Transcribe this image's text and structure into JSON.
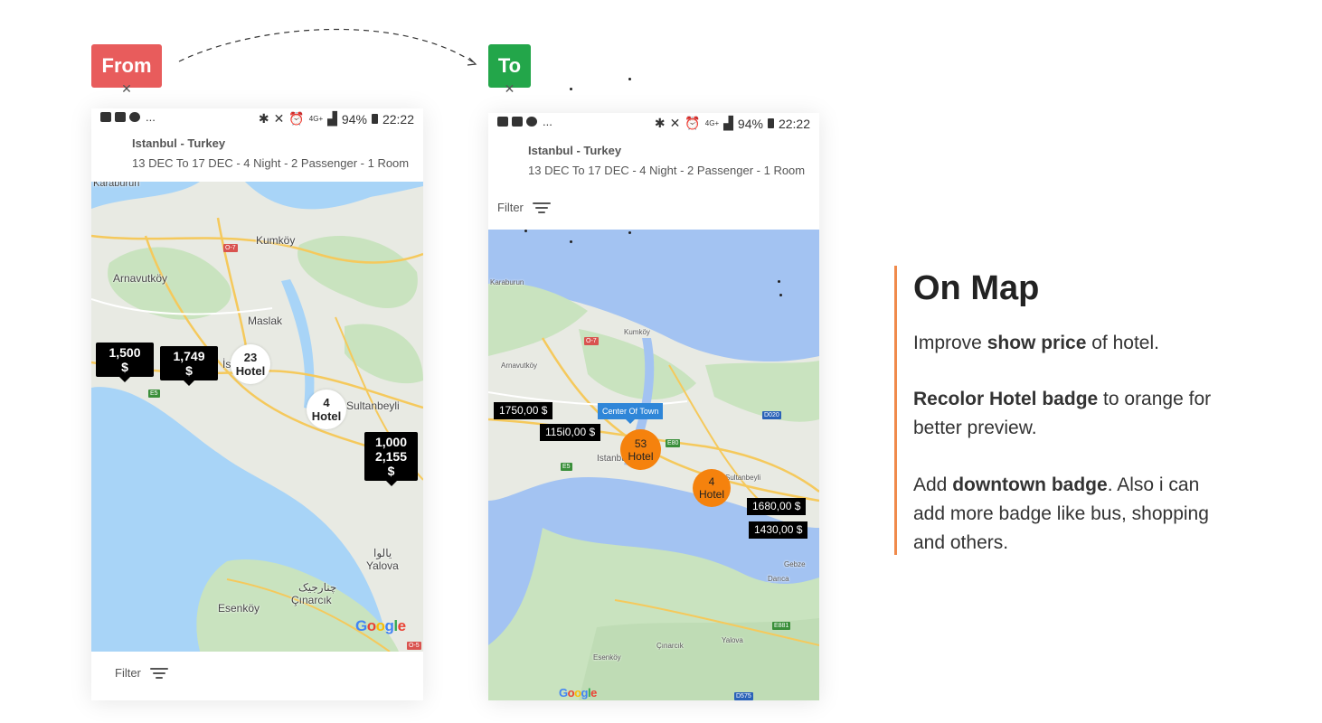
{
  "tags": {
    "from": "From",
    "to": "To",
    "from_color": "#e85c5c",
    "to_color": "#23a64a"
  },
  "statusbar": {
    "battery": "94%",
    "time": "22:22",
    "network": "4G+"
  },
  "header": {
    "city": "Istanbul - Turkey",
    "details": "13 DEC  To 17 DEC - 4 Night - 2 Passenger - 1 Room"
  },
  "filter_label": "Filter",
  "from_map": {
    "places": [
      "Karaburun",
      "Kumköy",
      "Arnavutköy",
      "Maslak",
      "İstanbul",
      "Sultanbeyli",
      "Yalova",
      "یالوا",
      "Çınarcık",
      "چنارجیک",
      "Esenköy"
    ],
    "road_labels": [
      "O-7",
      "E5",
      "O-5"
    ],
    "price_badges": [
      {
        "lines": [
          "1,500",
          "$"
        ]
      },
      {
        "lines": [
          "1,749",
          "$"
        ]
      },
      {
        "lines": [
          "1,000",
          "2,155",
          "$"
        ]
      }
    ],
    "clusters": [
      {
        "count": "23",
        "label": "Hotel"
      },
      {
        "count": "4",
        "label": "Hotel"
      }
    ],
    "logo": "Google"
  },
  "to_map": {
    "places": [
      "Karaburun",
      "Kumköy",
      "Arnavutköy",
      "Istanbul",
      "Gebze",
      "Darıca",
      "Yalova",
      "Çınarcık",
      "Esenköy",
      "Sultanbeyli"
    ],
    "road_labels": [
      "O-7",
      "E5",
      "E80",
      "D020",
      "E881",
      "D575"
    ],
    "prices": [
      "1750,00 $",
      "115i0,00 $",
      "1680,00 $",
      "1430,00 $"
    ],
    "clusters": [
      {
        "count": "53",
        "label": "Hotel"
      },
      {
        "count": "4",
        "label": "Hotel"
      }
    ],
    "downtown": "Center Of Town",
    "logo": "Google"
  },
  "panel": {
    "title": "On Map",
    "p1": {
      "before": "Improve ",
      "bold": "show price",
      "after": " of hotel."
    },
    "p2": {
      "bold": "Recolor Hotel badge",
      "after": " to orange for better preview."
    },
    "p3": {
      "before": "Add ",
      "bold": "downtown badge",
      "after": ". Also i can add more badge like bus, shopping and others."
    },
    "accent_color": "#f08a4b"
  }
}
